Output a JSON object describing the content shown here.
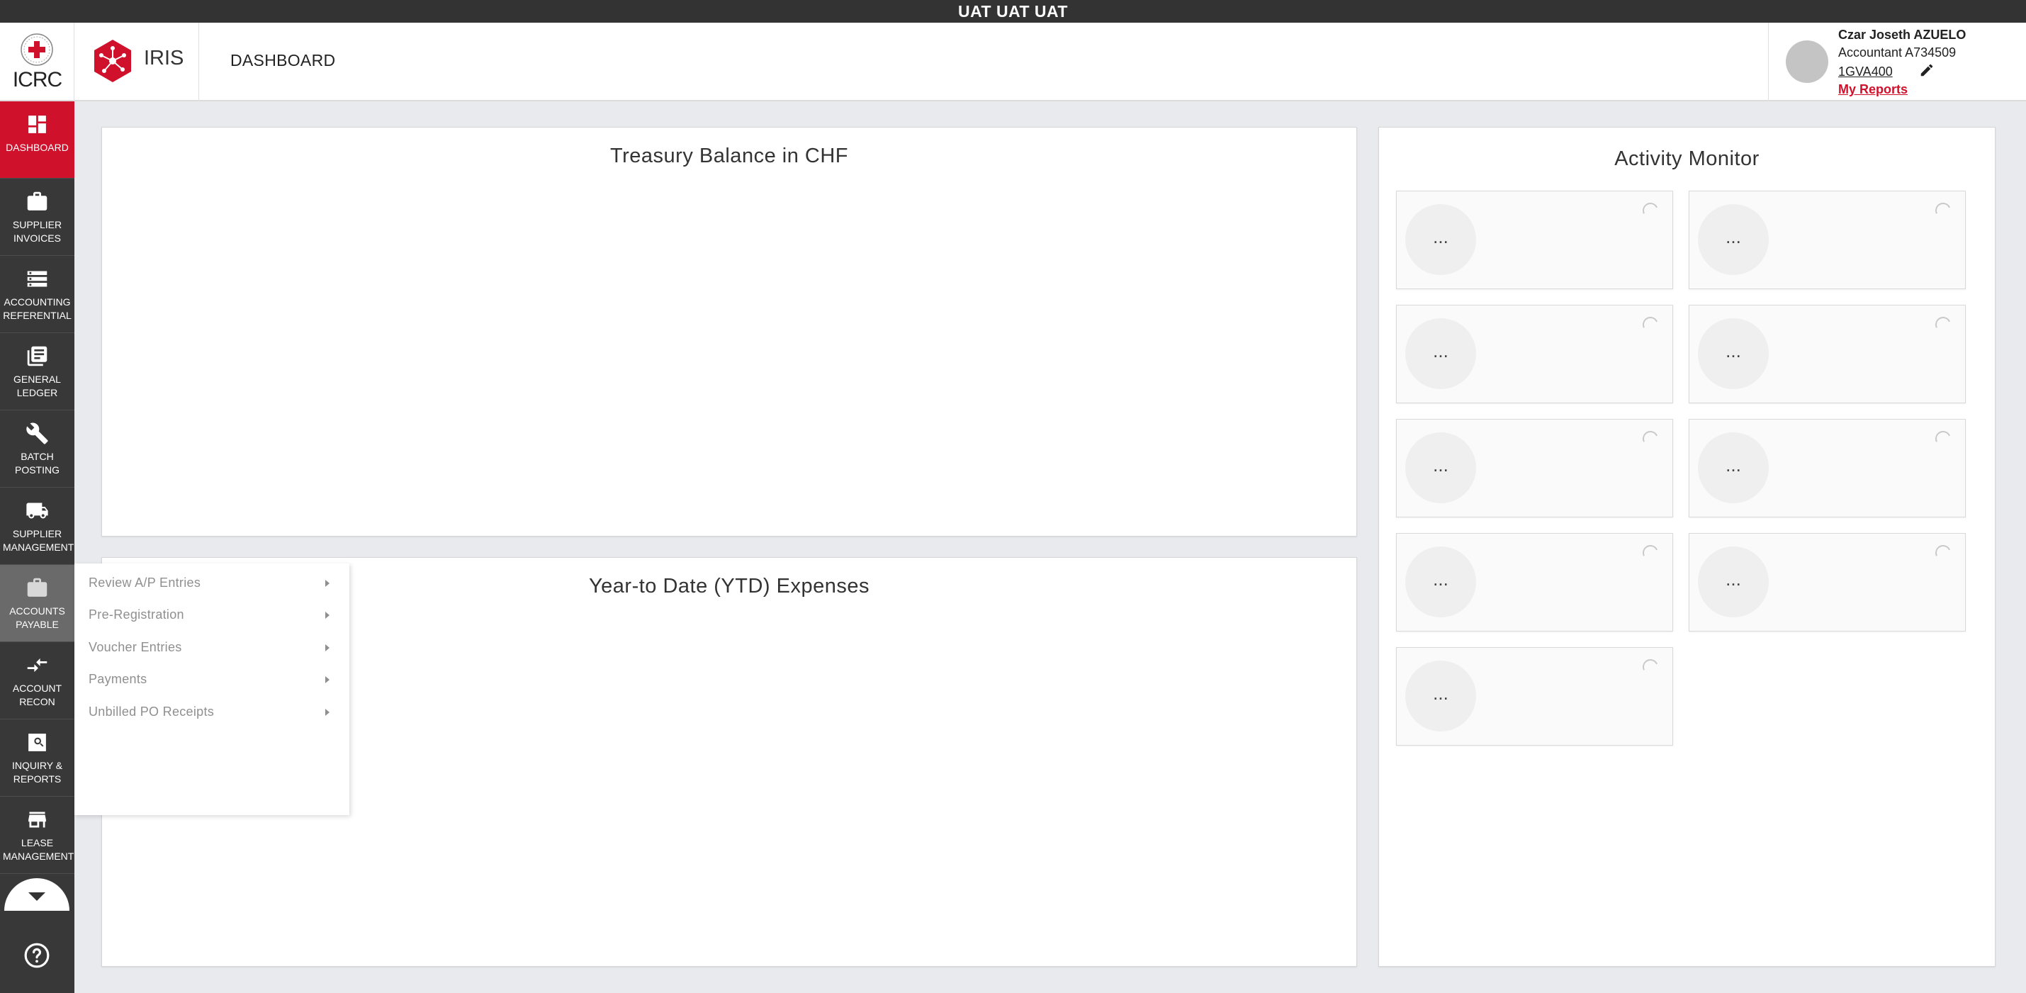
{
  "env_banner": "UAT UAT UAT",
  "header": {
    "org_name": "ICRC",
    "app_name": "IRIS",
    "page_title": "DASHBOARD",
    "user": {
      "name": "Czar Joseth AZUELO",
      "role": "Accountant A734509",
      "business_unit": "1GVA400",
      "reports_link": "My Reports"
    }
  },
  "colors": {
    "brand_red": "#d0112b",
    "sidebar_bg": "#383838",
    "env_bar": "#333333"
  },
  "sidebar": {
    "items": [
      {
        "label": "DASHBOARD",
        "icon": "dashboard-icon",
        "state": "active"
      },
      {
        "label": "SUPPLIER INVOICES",
        "icon": "briefcase-icon"
      },
      {
        "label": "ACCOUNTING REFERENTIAL",
        "icon": "storage-icon"
      },
      {
        "label": "GENERAL LEDGER",
        "icon": "ledger-icon"
      },
      {
        "label": "BATCH POSTING",
        "icon": "wrench-icon"
      },
      {
        "label": "SUPPLIER MANAGEMENT",
        "icon": "truck-icon"
      },
      {
        "label": "ACCOUNTS PAYABLE",
        "icon": "briefcase-icon",
        "state": "hover"
      },
      {
        "label": "ACCOUNT RECON",
        "icon": "compare-arrows-icon"
      },
      {
        "label": "INQUIRY & REPORTS",
        "icon": "search-icon"
      },
      {
        "label": "LEASE MANAGEMENT",
        "icon": "store-icon"
      }
    ],
    "more_icon": "chevron-down-icon",
    "help_icon": "help-icon"
  },
  "submenu": {
    "items": [
      "Review A/P Entries",
      "Pre-Registration",
      "Voucher Entries",
      "Payments",
      "Unbilled PO Receipts"
    ]
  },
  "panels": {
    "treasury_title": "Treasury Balance in CHF",
    "ytd_title": "Year-to Date (YTD) Expenses",
    "activity_title": "Activity Monitor"
  },
  "activity_tiles": [
    "...",
    "...",
    "...",
    "...",
    "...",
    "...",
    "...",
    "...",
    "..."
  ]
}
